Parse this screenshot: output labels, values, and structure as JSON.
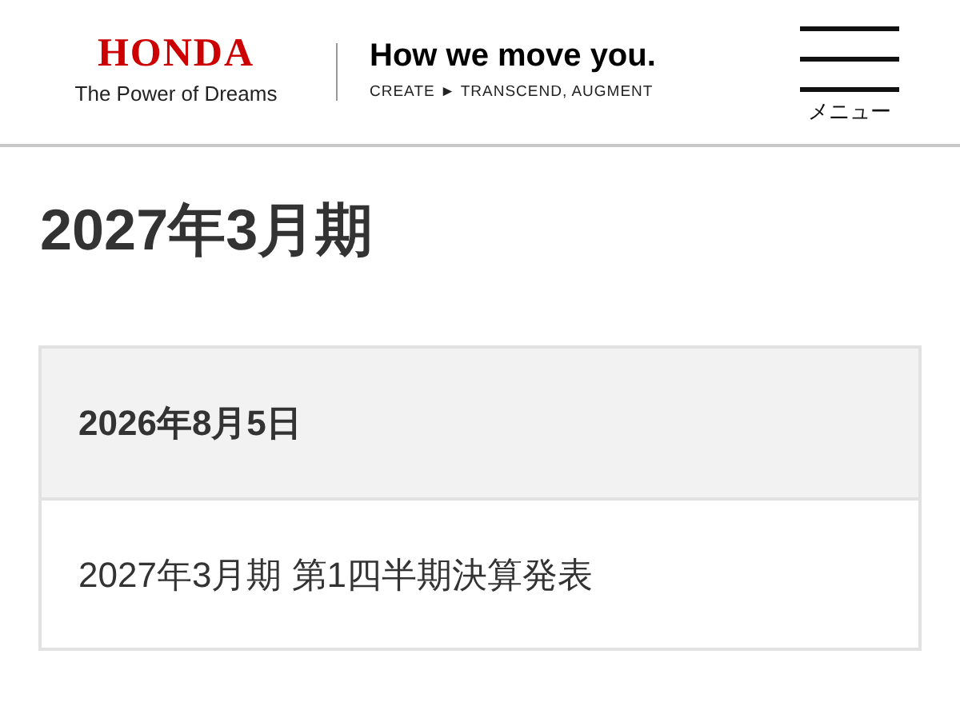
{
  "header": {
    "logo": "HONDA",
    "logo_slogan": "The Power of Dreams",
    "tagline": "How we move you.",
    "subtagline": "CREATE ► TRANSCEND, AUGMENT",
    "menu_label": "メニュー"
  },
  "page_title": "2027年3月期",
  "events": [
    {
      "date": "2026年8月5日",
      "title": "2027年3月期 第1四半期決算発表"
    }
  ]
}
